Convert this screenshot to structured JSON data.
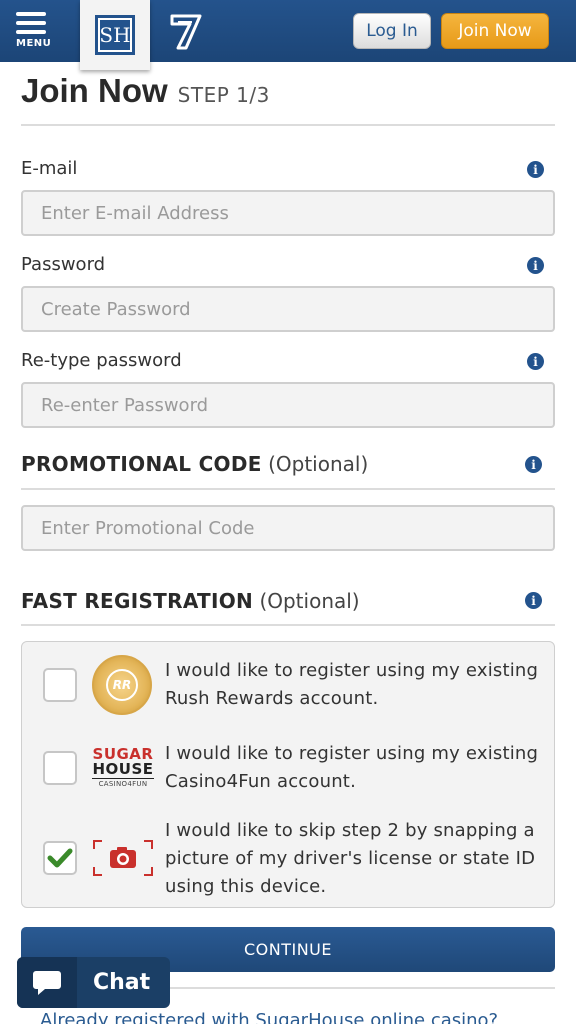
{
  "header": {
    "menu_label": "MENU",
    "logo_text": "SH",
    "login_label": "Log In",
    "join_label": "Join Now"
  },
  "page": {
    "title": "Join Now",
    "step": "STEP 1/3"
  },
  "form": {
    "email_label": "E-mail",
    "email_placeholder": "Enter E-mail Address",
    "password_label": "Password",
    "password_placeholder": "Create Password",
    "retype_label": "Re-type password",
    "retype_placeholder": "Re-enter Password",
    "promo_title": "PROMOTIONAL CODE",
    "promo_optional": "(Optional)",
    "promo_placeholder": "Enter Promotional Code",
    "fast_title": "FAST REGISTRATION",
    "fast_optional": "(Optional)",
    "info_glyph": "i"
  },
  "fast_options": [
    {
      "text": "I would like to register using my existing Rush Rewards account.",
      "checked": false,
      "logo": "rush-rewards-logo"
    },
    {
      "text": "I would like to register using my existing Casino4Fun account.",
      "checked": false,
      "logo": "sugarhouse-logo"
    },
    {
      "text": "I would like to skip step 2 by snapping a picture of my driver's license or state ID using this device.",
      "checked": true,
      "logo": "camera-icon"
    }
  ],
  "logos": {
    "rr_initials": "RR",
    "sugar_line1": "SUGAR",
    "sugar_line2": "HOUSE",
    "sugar_line3": "CASINO4FUN"
  },
  "actions": {
    "continue_label": "CONTINUE",
    "chat_label": "Chat",
    "already_registered": "Already registered with SugarHouse online casino?"
  },
  "colors": {
    "brand_blue": "#23538d",
    "join_orange": "#f0a72c",
    "check_green": "#3a8a2a",
    "camera_red": "#c9302c"
  }
}
